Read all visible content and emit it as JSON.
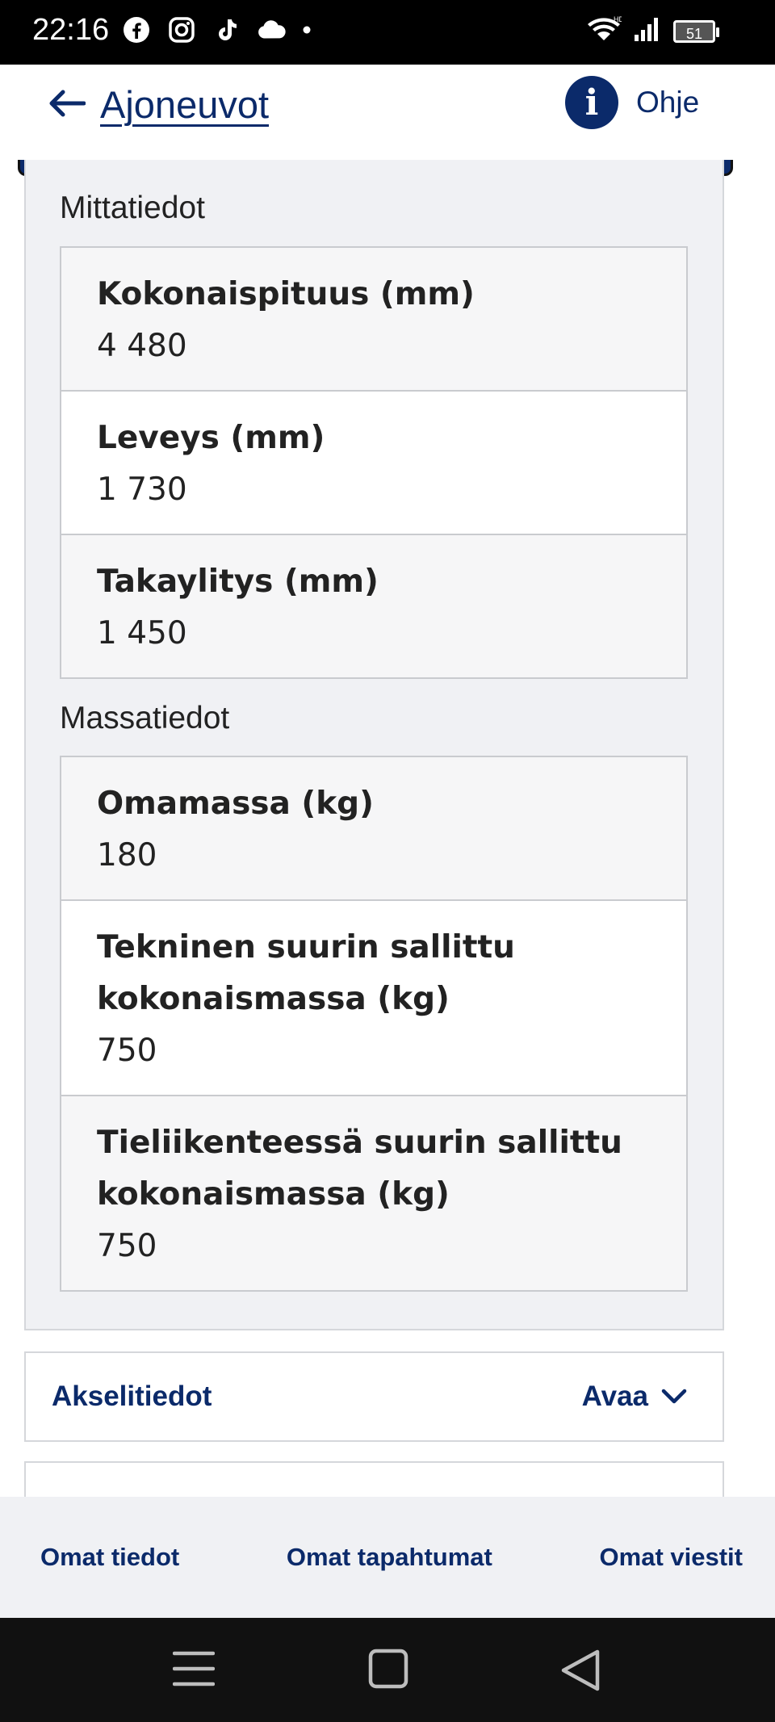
{
  "status_bar": {
    "time": "22:16",
    "battery": "51"
  },
  "header": {
    "back_label": "Ajoneuvot",
    "help_icon_glyph": "i",
    "help_label": "Ohje"
  },
  "sections": [
    {
      "title": "Mittatiedot",
      "rows": [
        {
          "label": "Kokonaispituus (mm)",
          "value": "4 480"
        },
        {
          "label": "Leveys (mm)",
          "value": "1 730"
        },
        {
          "label": "Takaylitys (mm)",
          "value": "1 450"
        }
      ]
    },
    {
      "title": "Massatiedot",
      "rows": [
        {
          "label": "Omamassa (kg)",
          "value": "180"
        },
        {
          "label": "Tekninen suurin sallittu kokonaismassa (kg)",
          "value": "750"
        },
        {
          "label": "Tieliikenteessä suurin sallittu kokonaismassa (kg)",
          "value": "750"
        }
      ]
    }
  ],
  "accordion": {
    "title": "Akselitiedot",
    "open_label": "Avaa"
  },
  "bottom_nav": {
    "items": [
      "Omat tiedot",
      "Omat tapahtumat",
      "Omat viestit"
    ]
  },
  "colors": {
    "brand": "#0b2a6a",
    "panel_bg": "#f0f1f4"
  }
}
